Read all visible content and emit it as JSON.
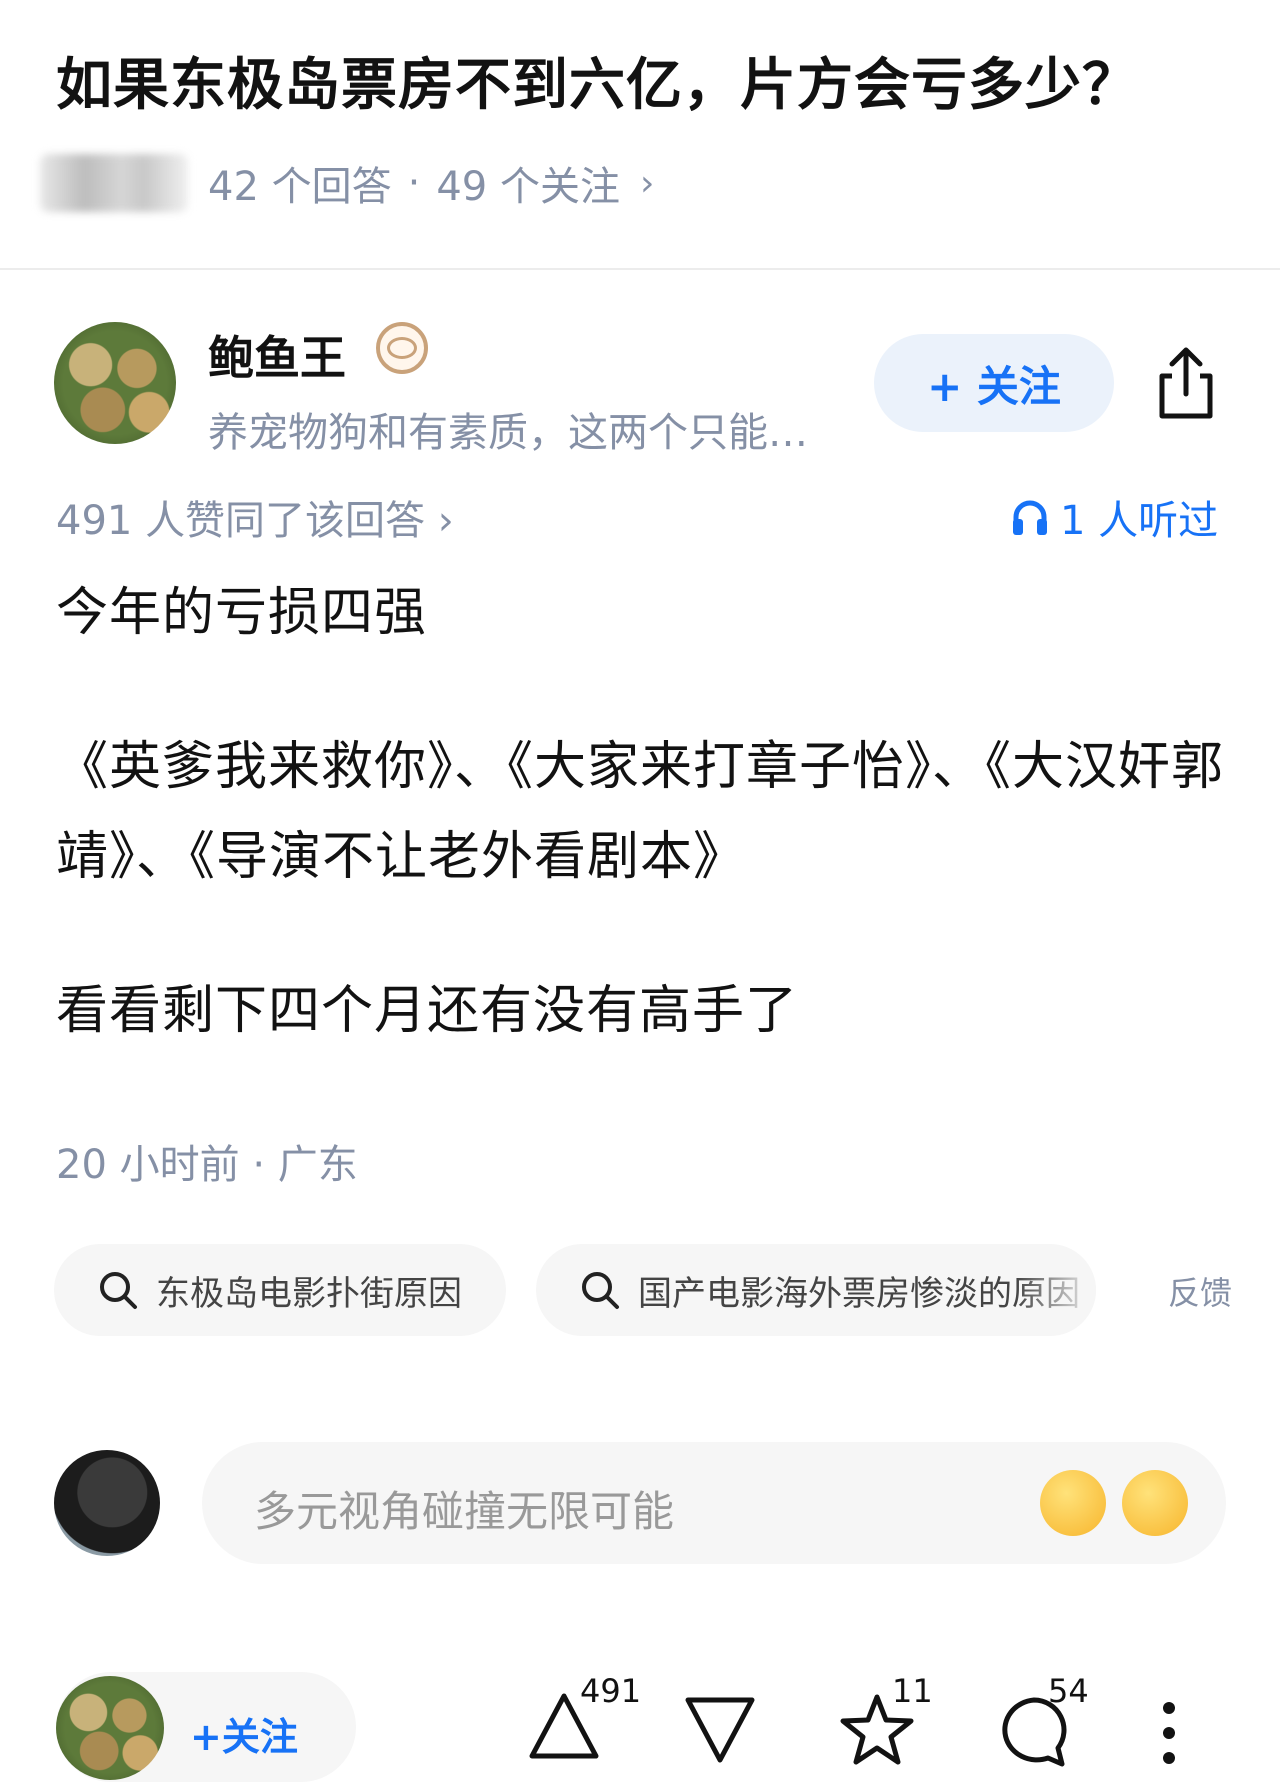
{
  "question": {
    "title": "如果东极岛票房不到六亿，片方会亏多少？",
    "answers_count": "42 个回答",
    "separator": "·",
    "followers_count": "49 个关注",
    "chevron": "›"
  },
  "author": {
    "name": "鲍鱼王",
    "bio": "养宠物狗和有素质，这两个只能…",
    "follow_label": "+ 关注",
    "avatar_icon": "abalone-avatar",
    "badge_icon": "eye-badge-icon"
  },
  "stats": {
    "upvote_text": "491 人赞同了该回答 ›",
    "listened_text": "1 人听过"
  },
  "answer": {
    "p1": "今年的亏损四强",
    "p2": "《英爹我来救你》、《大家来打章子怡》、《大汉奸郭靖》、《导演不让老外看剧本》",
    "p3": "看看剩下四个月还有没有高手了",
    "time_location": "20 小时前 · 广东"
  },
  "search_chips": [
    {
      "label": "东极岛电影扑街原因"
    },
    {
      "label": "国产电影海外票房惨淡的原因"
    }
  ],
  "feedback_label": "反馈",
  "comment": {
    "placeholder": "多元视角碰撞无限可能"
  },
  "bottom_bar": {
    "follow_label": "+关注",
    "upvote_count": "491",
    "favorite_count": "11",
    "comment_count": "54"
  },
  "colors": {
    "accent": "#1772f6",
    "meta_gray": "#8590a6",
    "chip_bg": "#f6f6f6"
  }
}
